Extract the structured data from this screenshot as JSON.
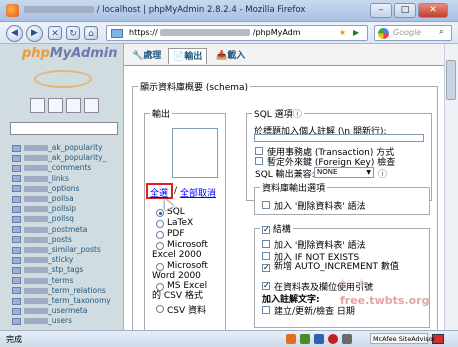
{
  "window": {
    "title_suffix": "/ localhost | phpMyAdmin 2.8.2.4 - Mozilla Firefox",
    "min": "–",
    "max": "□",
    "close": "✕"
  },
  "nav": {
    "back_icon": "back-arrow-icon",
    "url_prefix": "https://",
    "url_suffix": "/phpMyAdm",
    "search_placeholder": "Google",
    "go": "▶"
  },
  "pma": {
    "logo_php": "php",
    "logo_admin": "MyAdmin",
    "tables": [
      "_ak_popularity",
      "_ak_popularity_",
      "_comments",
      "_links",
      "_options",
      "_pollsa",
      "_pollsip",
      "_pollsq",
      "_postmeta",
      "_posts",
      "_similar_posts",
      "_sticky",
      "_stp_tags",
      "_terms",
      "_term_relations",
      "_term_taxonomy",
      "_usermeta",
      "_users"
    ]
  },
  "tabs": [
    {
      "label": "處理",
      "icon": "wrench-icon"
    },
    {
      "label": "輸出",
      "icon": "export-icon"
    },
    {
      "label": "載入",
      "icon": "import-icon"
    }
  ],
  "main": {
    "outer_legend": "顯示資料庫概要 (schema)",
    "export_legend": "輸出",
    "select_all": "全選",
    "deselect_all": "全部取消",
    "formats": [
      {
        "label": "SQL",
        "checked": true
      },
      {
        "label": "LaTeX",
        "checked": false
      },
      {
        "label": "PDF",
        "checked": false
      },
      {
        "label": "Microsoft Excel 2000",
        "checked": false
      },
      {
        "label": "Microsoft Word 2000",
        "checked": false
      },
      {
        "label": "MS Excel 的 CSV 格式",
        "checked": false
      },
      {
        "label": "CSV 資料",
        "checked": false
      }
    ],
    "sql_legend": "SQL 選項",
    "sql_comment": "於標題加入個人註解 (\\n 開新行):",
    "sql_opts": [
      {
        "label": "使用事務處 (Transaction) 方式",
        "checked": false
      },
      {
        "label": "暫定外來鍵 (Foreign Key) 檢查",
        "checked": false
      }
    ],
    "compat_label": "SQL 輸出兼容:",
    "compat_value": "NONE",
    "dbout_legend": "資料庫輸出選項",
    "dbout_opt": "加入 '刪除資料表' 語法",
    "struct_legend": "結構",
    "struct_opts": [
      {
        "label": "加入 '刪除資料表' 語法",
        "checked": false
      },
      {
        "label": "加入 IF NOT EXISTS",
        "checked": false
      },
      {
        "label": "新增 AUTO_INCREMENT 數值",
        "checked": true
      },
      {
        "label": "在資料表及欄位使用引號",
        "checked": true
      }
    ],
    "struct_comment_label": "加入註解文字:",
    "struct_opt_last": "建立/更新/檢查 日期"
  },
  "status": {
    "text": "完成",
    "mcafee": "McAfee SiteAdvisor"
  },
  "watermark": "free.twbts.org"
}
